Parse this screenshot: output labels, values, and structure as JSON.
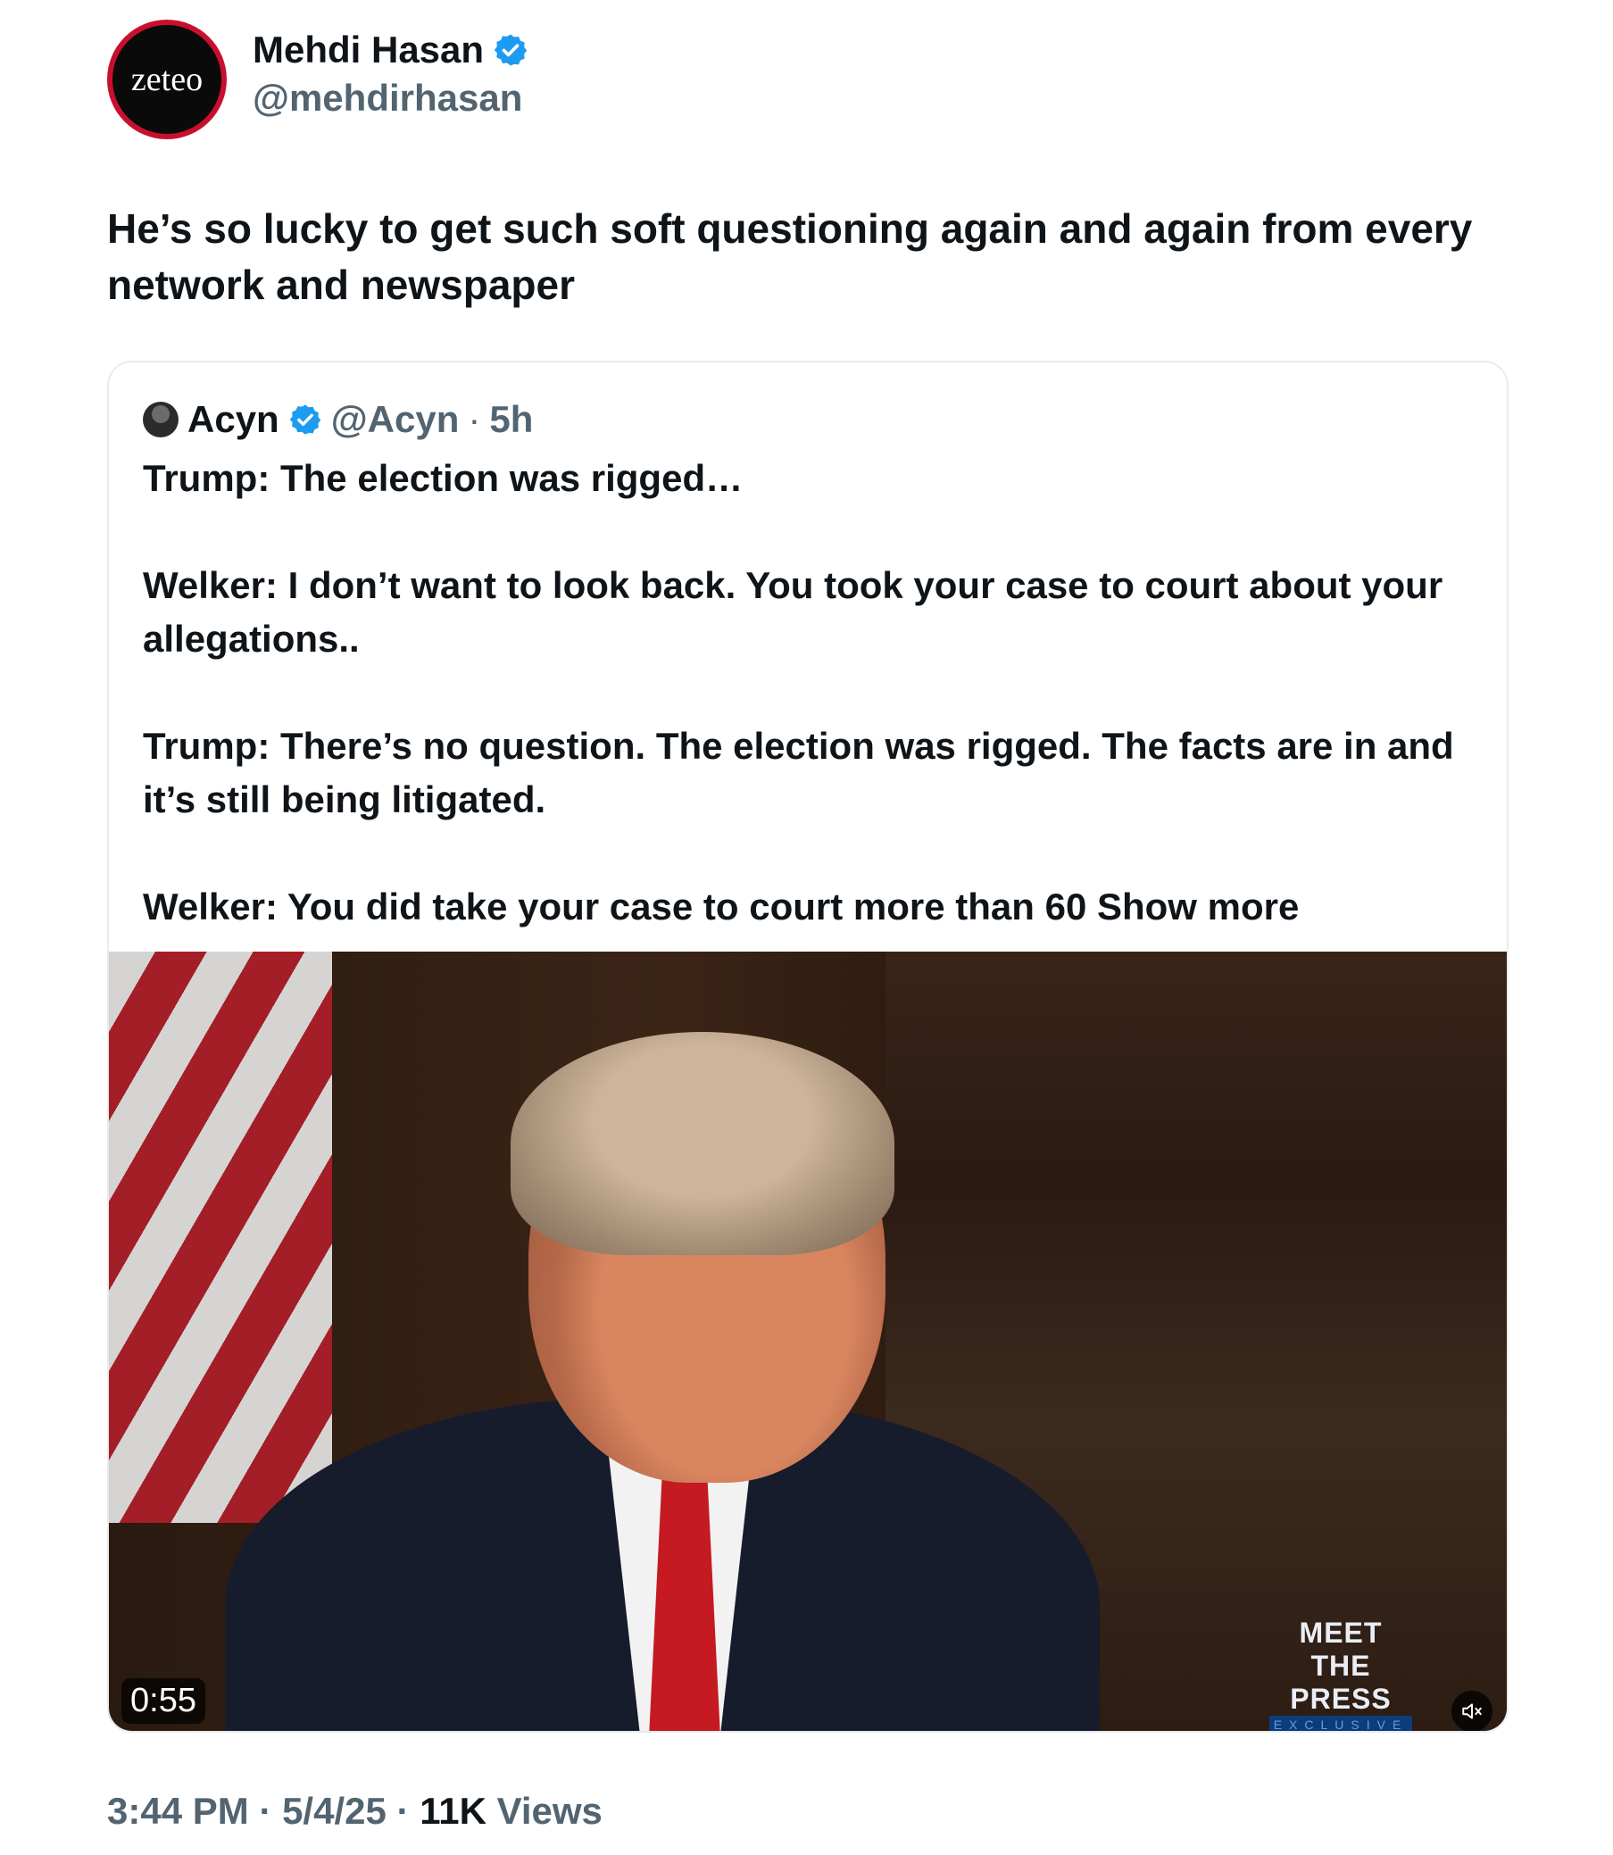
{
  "author": {
    "avatar_text": "zeteo",
    "display_name": "Mehdi Hasan",
    "handle": "@mehdirhasan",
    "verified_color": "#1d9bf0"
  },
  "tweet": {
    "text": "He’s so lucky to get such soft questioning again and again from every network and newspaper"
  },
  "quote": {
    "name": "Acyn",
    "handle": "@Acyn",
    "separator": "·",
    "time": "5h",
    "paragraphs": [
      "Trump: The election was rigged…",
      "Welker: I don’t want to look back. You took your case to court about your allegations..",
      "Trump: There’s no question. The election was rigged. The facts are in and it’s still being litigated.",
      "Welker: You did take your case to court more than 60"
    ],
    "show_more": "Show more"
  },
  "video": {
    "duration": "0:55",
    "logo_main": "MEET THE PRESS",
    "logo_sub": "EXCLUSIVE",
    "mute_icon": "muted-speaker-icon"
  },
  "meta": {
    "time": "3:44 PM",
    "sep": "·",
    "date": "5/4/25",
    "views_count": "11K",
    "views_label": "Views"
  }
}
